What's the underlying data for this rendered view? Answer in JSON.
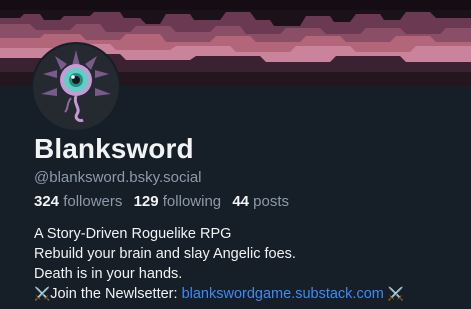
{
  "profile": {
    "display_name": "Blanksword",
    "handle": "@blanksword.bsky.social",
    "stats": {
      "followers_count": "324",
      "followers_label": "followers",
      "following_count": "129",
      "following_label": "following",
      "posts_count": "44",
      "posts_label": "posts"
    },
    "bio": {
      "line1": "A Story-Driven Roguelike RPG",
      "line2": "Rebuild your brain and slay Angelic foes.",
      "line3": "Death is in your hands.",
      "line4_prefix_emoji": "⚔️",
      "line4_text": "Join the Newlsetter: ",
      "line4_link": "blankswordgame.substack.com",
      "line4_suffix_emoji": "⚔️"
    }
  },
  "icons": {
    "avatar": "eyeball-monster-avatar-icon",
    "banner": "pixel-cave-banner"
  },
  "colors": {
    "background": "#161e27",
    "text_primary": "#f1f3f5",
    "text_secondary": "#8c9aab",
    "link": "#3b8bf7"
  }
}
